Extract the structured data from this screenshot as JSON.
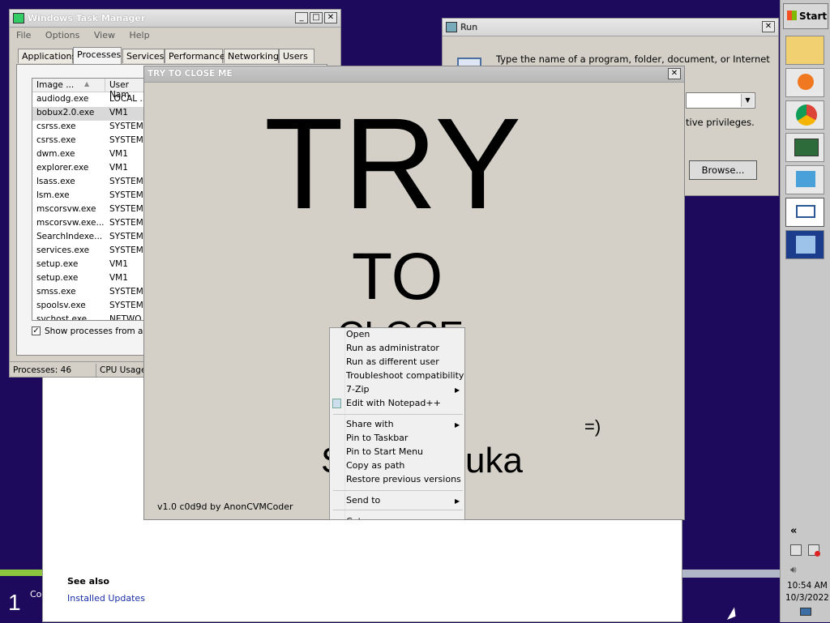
{
  "task_manager": {
    "title": "Windows Task Manager",
    "menu": [
      "File",
      "Options",
      "View",
      "Help"
    ],
    "tabs": [
      "Applications",
      "Processes",
      "Services",
      "Performance",
      "Networking",
      "Users"
    ],
    "columns": [
      "Image ...",
      "User Nam"
    ],
    "processes": [
      {
        "image": "audiodg.exe",
        "user": "LOCAL ..."
      },
      {
        "image": "bobux2.0.exe",
        "user": "VM1"
      },
      {
        "image": "csrss.exe",
        "user": "SYSTEM"
      },
      {
        "image": "csrss.exe",
        "user": "SYSTEM"
      },
      {
        "image": "dwm.exe",
        "user": "VM1"
      },
      {
        "image": "explorer.exe",
        "user": "VM1"
      },
      {
        "image": "lsass.exe",
        "user": "SYSTEM"
      },
      {
        "image": "lsm.exe",
        "user": "SYSTEM"
      },
      {
        "image": "mscorsvw.exe",
        "user": "SYSTEM"
      },
      {
        "image": "mscorsvw.exe...",
        "user": "SYSTEM"
      },
      {
        "image": "SearchIndexe...",
        "user": "SYSTEM"
      },
      {
        "image": "services.exe",
        "user": "SYSTEM"
      },
      {
        "image": "setup.exe",
        "user": "VM1"
      },
      {
        "image": "setup.exe",
        "user": "VM1"
      },
      {
        "image": "smss.exe",
        "user": "SYSTEM"
      },
      {
        "image": "spoolsv.exe",
        "user": "SYSTEM"
      },
      {
        "image": "svchost.exe",
        "user": "NETWO..."
      }
    ],
    "show_all_label": "Show processes from all u",
    "show_all_checked": true,
    "status_processes": "Processes: 46",
    "status_cpu": "CPU Usage"
  },
  "run_dialog": {
    "title": "Run",
    "description": "Type the name of a program, folder, document, or Internet",
    "privileges_text": "tive privileges.",
    "browse_label": "Browse..."
  },
  "prank_window": {
    "title": "TRY TO CLOSE ME",
    "big_try": "TRY",
    "big_to": "TO",
    "big_close": "CLOSE",
    "smiley": "=)",
    "partial_name_left": "S",
    "partial_name_right": "uka",
    "version": "v1.0 c0d9d by AnonCVMCoder"
  },
  "context_menu": {
    "items": [
      {
        "label": "Open",
        "submenu": false
      },
      {
        "label": "Run as administrator",
        "submenu": false
      },
      {
        "label": "Run as different user",
        "submenu": false
      },
      {
        "label": "Troubleshoot compatibility",
        "submenu": false
      },
      {
        "label": "7-Zip",
        "submenu": true
      },
      {
        "label": "Edit with Notepad++",
        "submenu": false
      },
      {
        "label": "Share with",
        "submenu": true
      },
      {
        "label": "Pin to Taskbar",
        "submenu": false
      },
      {
        "label": "Pin to Start Menu",
        "submenu": false
      },
      {
        "label": "Copy as path",
        "submenu": false
      },
      {
        "label": "Restore previous versions",
        "submenu": false
      },
      {
        "label": "Send to",
        "submenu": true
      },
      {
        "label": "Cut",
        "submenu": false
      }
    ]
  },
  "background_window": {
    "see_also": "See also",
    "installed_updates": "Installed Updates",
    "left_number": "1",
    "left_text": "Co"
  },
  "taskbar": {
    "start_label": "Start",
    "expand": "«",
    "time": "10:54 AM",
    "date": "10/3/2022",
    "icons": [
      "windows-explorer-icon",
      "media-player-icon",
      "chrome-icon",
      "task-manager-icon",
      "install-icon",
      "run-icon",
      "control-panel-icon"
    ]
  },
  "colors": {
    "desktop": "#1d0a5c",
    "window_bg": "#d4d0c8",
    "link": "#1a2fa8"
  }
}
